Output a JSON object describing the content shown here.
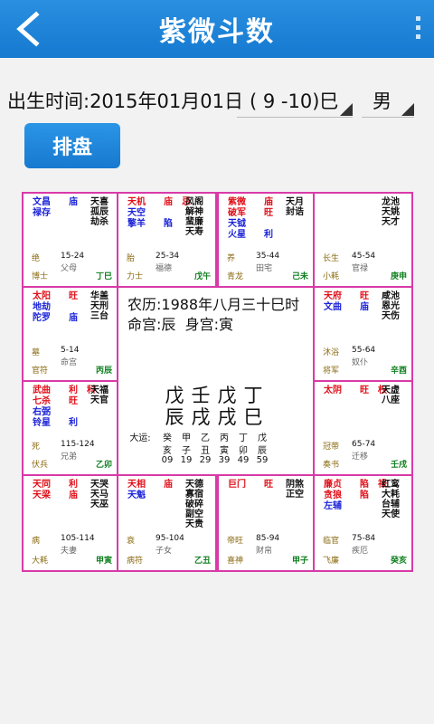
{
  "header": {
    "title": "紫微斗数"
  },
  "form": {
    "birth_label": "出生时间:2015年01月01日",
    "hour_value": "( 9 -10)巳",
    "gender_value": "男",
    "submit_label": "排盘"
  },
  "center": {
    "lunar": "农历:1988年八月三十巳时",
    "palace": "命宫:辰  身宫:寅",
    "bazi_top": "戊壬戊丁",
    "bazi_bottom": "辰戌戌巳",
    "dayun_label": "大运:",
    "dayun_stems": [
      "癸",
      "甲",
      "乙",
      "丙",
      "丁",
      "戊"
    ],
    "dayun_branches": [
      "亥",
      "子",
      "丑",
      "寅",
      "卯",
      "辰"
    ],
    "dayun_ages": [
      "09",
      "19",
      "29",
      "39",
      "49",
      "59"
    ]
  },
  "cells": [
    {
      "id": "si",
      "stars": [
        {
          "n": "文昌",
          "b": "庙",
          "c": "blue"
        },
        {
          "n": "禄存",
          "b": "",
          "c": "blue"
        }
      ],
      "minor": [
        "天喜",
        "孤辰",
        "劫杀"
      ],
      "lsth": "绝",
      "range": "15-24",
      "palace": "父母",
      "god": "博士",
      "branch": "丁巳"
    },
    {
      "id": "wu",
      "stars": [
        {
          "n": "天机",
          "b": "庙",
          "c": "red",
          "h": "忌"
        },
        {
          "n": "天空",
          "b": "",
          "c": "blue"
        },
        {
          "n": "擎羊",
          "b": "陷",
          "c": "blue"
        }
      ],
      "minor": [
        "风阁",
        "解神",
        "蜚廉",
        "天寿"
      ],
      "lsth": "胎",
      "range": "25-34",
      "palace": "福德",
      "god": "力士",
      "branch": "戊午"
    },
    {
      "id": "wei",
      "stars": [
        {
          "n": "紫微",
          "b": "庙",
          "c": "red"
        },
        {
          "n": "破军",
          "b": "旺",
          "c": "red"
        },
        {
          "n": "天钺",
          "b": "",
          "c": "blue"
        },
        {
          "n": "火星",
          "b": "利",
          "c": "blue"
        }
      ],
      "minor": [
        "天月",
        "封诰"
      ],
      "lsth": "养",
      "range": "35-44",
      "palace": "田宅",
      "god": "青龙",
      "branch": "己未"
    },
    {
      "id": "shen",
      "stars": [],
      "minor": [
        "龙池",
        "天姚",
        "天才"
      ],
      "lsth": "长生",
      "range": "45-54",
      "palace": "官禄",
      "god": "小耗",
      "branch": "庚申"
    },
    {
      "id": "chen",
      "stars": [
        {
          "n": "太阳",
          "b": "旺",
          "c": "red"
        },
        {
          "n": "地劫",
          "b": "",
          "c": "blue"
        },
        {
          "n": "陀罗",
          "b": "庙",
          "c": "blue"
        }
      ],
      "minor": [
        "华盖",
        "天刑",
        "三台"
      ],
      "lsth": "墓",
      "range": "5-14",
      "palace": "命宫",
      "god": "官符",
      "branch": "丙辰"
    },
    {
      "id": "you",
      "stars": [
        {
          "n": "天府",
          "b": "旺",
          "c": "red"
        },
        {
          "n": "文曲",
          "b": "庙",
          "c": "blue"
        }
      ],
      "minor": [
        "咸池",
        "恩光",
        "天伤"
      ],
      "lsth": "沐浴",
      "range": "55-64",
      "palace": "奴仆",
      "god": "将军",
      "branch": "辛酉"
    },
    {
      "id": "mao",
      "stars": [
        {
          "n": "武曲",
          "b": "利",
          "c": "red",
          "h": "科"
        },
        {
          "n": "七杀",
          "b": "旺",
          "c": "red"
        },
        {
          "n": "右弼",
          "b": "",
          "c": "blue"
        },
        {
          "n": "铃星",
          "b": "利",
          "c": "blue"
        }
      ],
      "minor": [
        "天福",
        "天官"
      ],
      "lsth": "死",
      "range": "115-124",
      "palace": "兄弟",
      "god": "伏兵",
      "branch": "乙卯"
    },
    {
      "id": "xu",
      "stars": [
        {
          "n": "太阴",
          "b": "旺",
          "c": "red",
          "h": "权"
        }
      ],
      "minor": [
        "天虚",
        "八座"
      ],
      "lsth": "冠带",
      "range": "65-74",
      "palace": "迁移",
      "god": "奏书",
      "branch": "壬戌"
    },
    {
      "id": "yin",
      "stars": [
        {
          "n": "天同",
          "b": "利",
          "c": "red"
        },
        {
          "n": "天梁",
          "b": "庙",
          "c": "red"
        }
      ],
      "minor": [
        "天哭",
        "天马",
        "天巫"
      ],
      "lsth": "病",
      "range": "105-114",
      "palace": "夫妻",
      "god": "大耗",
      "branch": "甲寅"
    },
    {
      "id": "chou",
      "stars": [
        {
          "n": "天相",
          "b": "庙",
          "c": "red"
        },
        {
          "n": "天魁",
          "b": "",
          "c": "blue"
        }
      ],
      "minor": [
        "天德",
        "寡宿",
        "破碎",
        "副空",
        "天贵"
      ],
      "lsth": "衰",
      "range": "95-104",
      "palace": "子女",
      "god": "病符",
      "branch": "乙丑"
    },
    {
      "id": "zi",
      "stars": [
        {
          "n": "巨门",
          "b": "旺",
          "c": "red"
        }
      ],
      "minor": [
        "阴煞",
        "正空"
      ],
      "lsth": "帝旺",
      "range": "85-94",
      "palace": "财帛",
      "god": "喜神",
      "branch": "甲子"
    },
    {
      "id": "hai",
      "stars": [
        {
          "n": "廉贞",
          "b": "陷",
          "c": "red",
          "h": "禄"
        },
        {
          "n": "贪狼",
          "b": "陷",
          "c": "red"
        },
        {
          "n": "左辅",
          "b": "",
          "c": "blue"
        }
      ],
      "minor": [
        "红鸾",
        "大耗",
        "台辅",
        "天使"
      ],
      "lsth": "临官",
      "range": "75-84",
      "palace": "疾厄",
      "god": "飞廉",
      "branch": "癸亥"
    }
  ]
}
